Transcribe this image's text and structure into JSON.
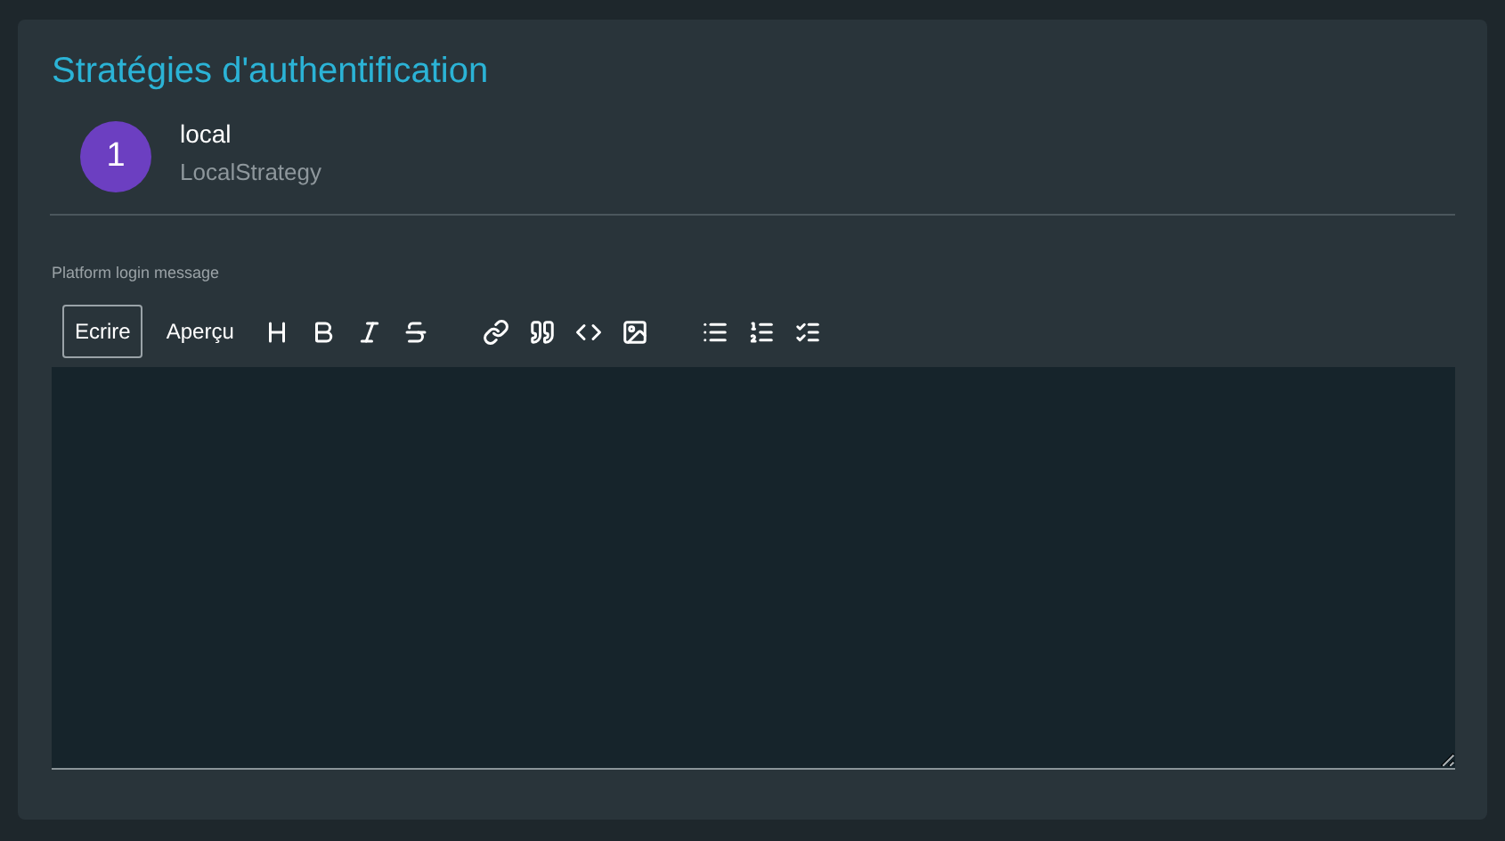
{
  "title": "Stratégies d'authentification",
  "strategies": [
    {
      "number": "1",
      "name": "local",
      "type": "LocalStrategy"
    }
  ],
  "editor": {
    "label": "Platform login message",
    "tabs": [
      {
        "label": "Ecrire",
        "selected": true
      },
      {
        "label": "Aperçu",
        "selected": false
      }
    ]
  }
}
